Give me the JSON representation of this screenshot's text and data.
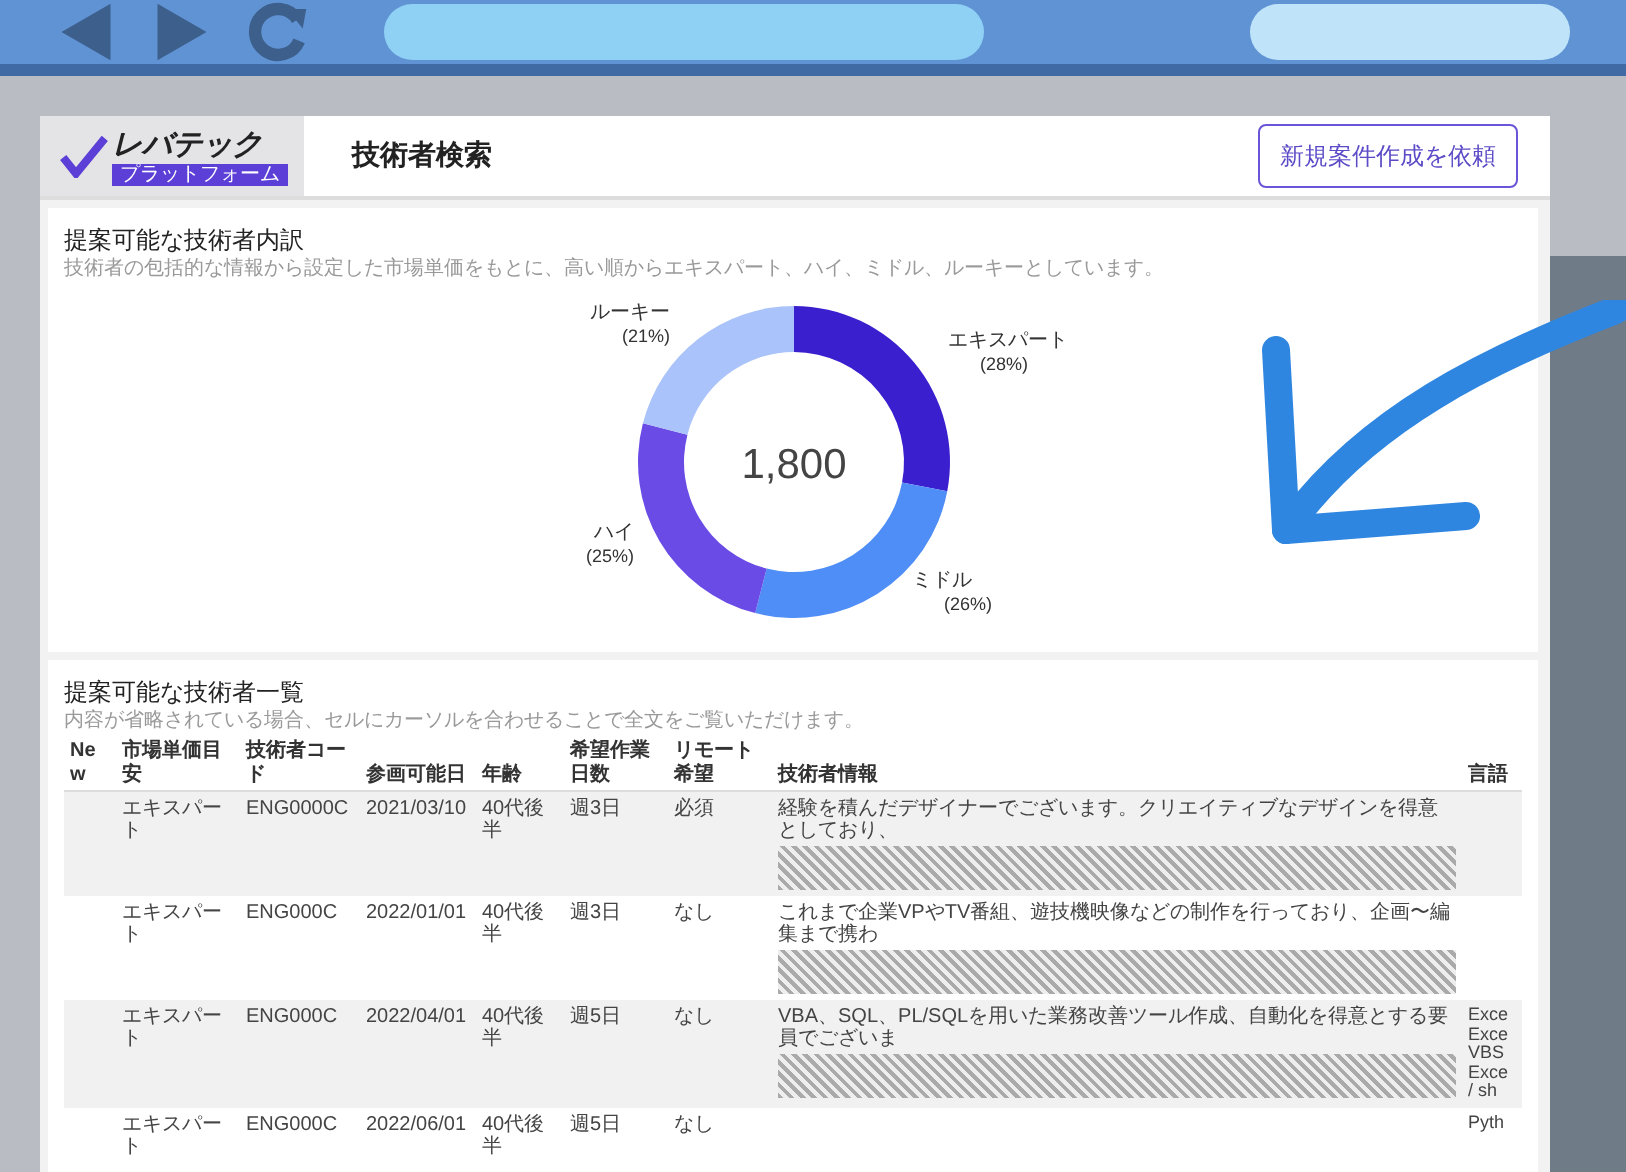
{
  "header": {
    "logo": {
      "name": "レバテック",
      "tagline": "プラットフォーム"
    },
    "title": "技術者検索",
    "button": "新規案件作成を依頼"
  },
  "breakdown": {
    "title": "提案可能な技術者内訳",
    "description": "技術者の包括的な情報から設定した市場単価をもとに、高い順からエキスパート、ハイ、ミドル、ルーキーとしています。",
    "total": "1,800",
    "chart_data": {
      "type": "donut",
      "categories": [
        "エキスパート",
        "ミドル",
        "ハイ",
        "ルーキー"
      ],
      "values": [
        28,
        26,
        25,
        21
      ],
      "value_labels": [
        "(28%)",
        "(26%)",
        "(25%)",
        "(21%)"
      ],
      "colors": [
        "#3a1fcf",
        "#4f8df7",
        "#6a4be6",
        "#aac3fa"
      ]
    }
  },
  "list": {
    "title": "提案可能な技術者一覧",
    "description": "内容が省略されている場合、セルにカーソルを合わせることで全文をご覧いただけます。",
    "columns": [
      "New",
      "市場単価目安",
      "技術者コード",
      "参画可能日",
      "年齢",
      "希望作業日数",
      "リモート希望",
      "技術者情報",
      "言語"
    ],
    "rows": [
      {
        "cells": [
          "",
          "エキスパート",
          "ENG0000C",
          "2021/03/10",
          "40代後半",
          "週3日",
          "必須"
        ],
        "info": "経験を積んだデザイナーでございます。クリエイティブなデザインを得意としており、",
        "languages": []
      },
      {
        "cells": [
          "",
          "エキスパート",
          "ENG000C",
          "2022/01/01",
          "40代後半",
          "週3日",
          "なし"
        ],
        "info": "これまで企業VPやTV番組、遊技機映像などの制作を行っており、企画〜編集まで携わ",
        "languages": []
      },
      {
        "cells": [
          "",
          "エキスパート",
          "ENG000C",
          "2022/04/01",
          "40代後半",
          "週5日",
          "なし"
        ],
        "info": "VBA、SQL、PL/SQLを用いた業務改善ツール作成、自動化を得意とする要員でございま",
        "languages": [
          "Exce",
          "Exce",
          "VBS",
          "Exce",
          "/ sh"
        ]
      },
      {
        "cells": [
          "",
          "エキスパート",
          "ENG000C",
          "2022/06/01",
          "40代後半",
          "週5日",
          "なし"
        ],
        "info": "",
        "languages": [
          "Pyth"
        ]
      }
    ]
  }
}
